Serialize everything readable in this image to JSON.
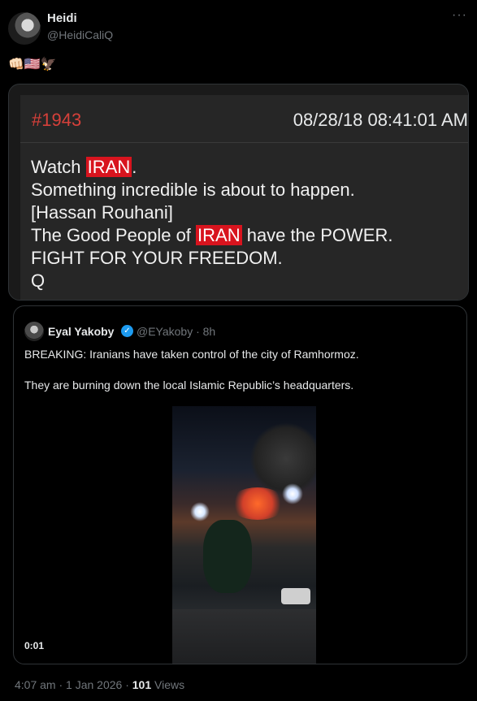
{
  "post": {
    "display_name": "Heidi",
    "handle": "@HeidiCaliQ",
    "more_icon": "more-options-icon",
    "emoji_text": "👊🏻🇺🇸🦅"
  },
  "qdrop": {
    "number": "#1943",
    "datetime": "08/28/18 08:41:01 AM",
    "line1_prefix": "Watch ",
    "line1_highlight": "IRAN",
    "line1_suffix": ".",
    "line2": "Something incredible is about to happen.",
    "line3": "[Hassan Rouhani]",
    "line4_prefix": "The Good People of ",
    "line4_highlight": "IRAN",
    "line4_suffix": " have the POWER.",
    "line5": "FIGHT FOR YOUR FREEDOM.",
    "line6": "Q",
    "highlight_color": "#d8141e",
    "number_color": "#d6403a"
  },
  "quoted": {
    "display_name": "Eyal Yakoby",
    "verified_icon": "verified-badge-icon",
    "handle_time": "@EYakoby · 8h",
    "text1": "BREAKING: Iranians have taken control of the city of Ramhormoz.",
    "text2": "They are burning down the local Islamic Republic’s headquarters.",
    "video_time": "0:01"
  },
  "footer": {
    "timestamp": "4:07 am · 1 Jan 2026 · ",
    "views_count": "101",
    "views_label": " Views"
  },
  "colors": {
    "background": "#000000",
    "text": "#e7e9ea",
    "muted": "#71767b",
    "verified": "#1d9bf0"
  }
}
